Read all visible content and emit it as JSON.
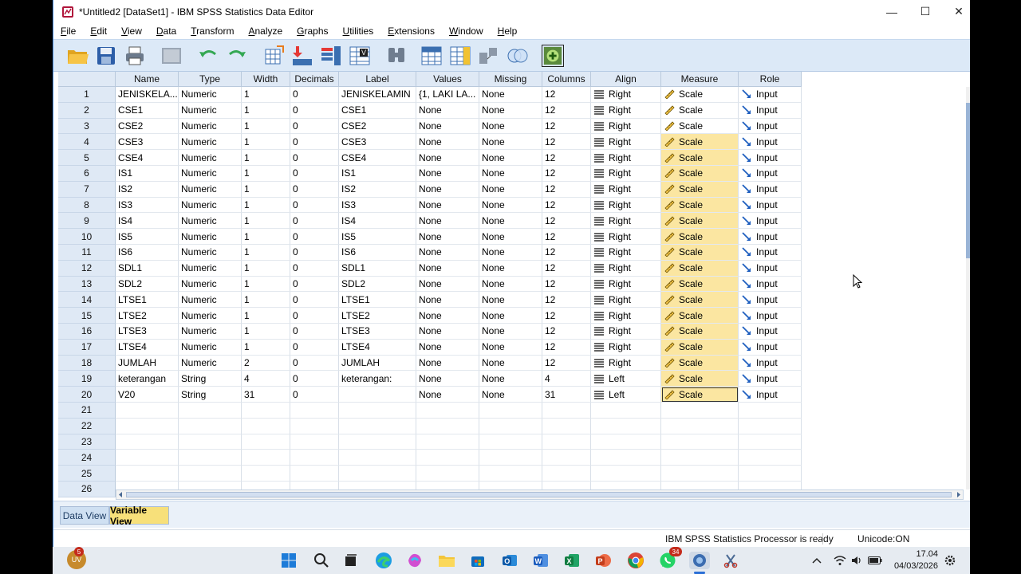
{
  "window": {
    "title": "*Untitled2 [DataSet1] - IBM SPSS Statistics Data Editor",
    "controls": {
      "minimize": "—",
      "maximize": "☐",
      "close": "✕"
    }
  },
  "menu": [
    {
      "label": "File"
    },
    {
      "label": "Edit"
    },
    {
      "label": "View"
    },
    {
      "label": "Data"
    },
    {
      "label": "Transform"
    },
    {
      "label": "Analyze"
    },
    {
      "label": "Graphs"
    },
    {
      "label": "Utilities"
    },
    {
      "label": "Extensions"
    },
    {
      "label": "Window"
    },
    {
      "label": "Help"
    }
  ],
  "toolbar_icons": [
    "open-folder-icon",
    "save-icon",
    "print-icon",
    "dialog-recall-icon",
    "undo-icon",
    "redo-icon",
    "goto-case-icon",
    "goto-variable-icon",
    "variables-icon",
    "run-descriptives-icon",
    "find-icon",
    "insert-cases-icon",
    "insert-variable-icon",
    "split-file-icon",
    "weight-cases-icon",
    "select-cases-icon",
    "add-icon"
  ],
  "table": {
    "headers": [
      "Name",
      "Type",
      "Width",
      "Decimals",
      "Label",
      "Values",
      "Missing",
      "Columns",
      "Align",
      "Measure",
      "Role"
    ],
    "rows": [
      [
        "1",
        "JENISKELA...",
        "Numeric",
        "1",
        "0",
        "JENISKELAMIN",
        "{1, LAKI LA...",
        "None",
        "12",
        "Right",
        "Scale",
        "Input"
      ],
      [
        "2",
        "CSE1",
        "Numeric",
        "1",
        "0",
        "CSE1",
        "None",
        "None",
        "12",
        "Right",
        "Scale",
        "Input"
      ],
      [
        "3",
        "CSE2",
        "Numeric",
        "1",
        "0",
        "CSE2",
        "None",
        "None",
        "12",
        "Right",
        "Scale",
        "Input"
      ],
      [
        "4",
        "CSE3",
        "Numeric",
        "1",
        "0",
        "CSE3",
        "None",
        "None",
        "12",
        "Right",
        "Scale",
        "Input"
      ],
      [
        "5",
        "CSE4",
        "Numeric",
        "1",
        "0",
        "CSE4",
        "None",
        "None",
        "12",
        "Right",
        "Scale",
        "Input"
      ],
      [
        "6",
        "IS1",
        "Numeric",
        "1",
        "0",
        "IS1",
        "None",
        "None",
        "12",
        "Right",
        "Scale",
        "Input"
      ],
      [
        "7",
        "IS2",
        "Numeric",
        "1",
        "0",
        "IS2",
        "None",
        "None",
        "12",
        "Right",
        "Scale",
        "Input"
      ],
      [
        "8",
        "IS3",
        "Numeric",
        "1",
        "0",
        "IS3",
        "None",
        "None",
        "12",
        "Right",
        "Scale",
        "Input"
      ],
      [
        "9",
        "IS4",
        "Numeric",
        "1",
        "0",
        "IS4",
        "None",
        "None",
        "12",
        "Right",
        "Scale",
        "Input"
      ],
      [
        "10",
        "IS5",
        "Numeric",
        "1",
        "0",
        "IS5",
        "None",
        "None",
        "12",
        "Right",
        "Scale",
        "Input"
      ],
      [
        "11",
        "IS6",
        "Numeric",
        "1",
        "0",
        "IS6",
        "None",
        "None",
        "12",
        "Right",
        "Scale",
        "Input"
      ],
      [
        "12",
        "SDL1",
        "Numeric",
        "1",
        "0",
        "SDL1",
        "None",
        "None",
        "12",
        "Right",
        "Scale",
        "Input"
      ],
      [
        "13",
        "SDL2",
        "Numeric",
        "1",
        "0",
        "SDL2",
        "None",
        "None",
        "12",
        "Right",
        "Scale",
        "Input"
      ],
      [
        "14",
        "LTSE1",
        "Numeric",
        "1",
        "0",
        "LTSE1",
        "None",
        "None",
        "12",
        "Right",
        "Scale",
        "Input"
      ],
      [
        "15",
        "LTSE2",
        "Numeric",
        "1",
        "0",
        "LTSE2",
        "None",
        "None",
        "12",
        "Right",
        "Scale",
        "Input"
      ],
      [
        "16",
        "LTSE3",
        "Numeric",
        "1",
        "0",
        "LTSE3",
        "None",
        "None",
        "12",
        "Right",
        "Scale",
        "Input"
      ],
      [
        "17",
        "LTSE4",
        "Numeric",
        "1",
        "0",
        "LTSE4",
        "None",
        "None",
        "12",
        "Right",
        "Scale",
        "Input"
      ],
      [
        "18",
        "JUMLAH",
        "Numeric",
        "2",
        "0",
        "JUMLAH",
        "None",
        "None",
        "12",
        "Right",
        "Scale",
        "Input"
      ],
      [
        "19",
        "keterangan",
        "String",
        "4",
        "0",
        "keterangan:",
        "None",
        "None",
        "4",
        "Left",
        "Scale",
        "Input"
      ],
      [
        "20",
        "V20",
        "String",
        "31",
        "0",
        "",
        "None",
        "None",
        "31",
        "Left",
        "Scale",
        "Input"
      ],
      [
        "21",
        "",
        "",
        "",
        "",
        "",
        "",
        "",
        "",
        "",
        "",
        ""
      ],
      [
        "22",
        "",
        "",
        "",
        "",
        "",
        "",
        "",
        "",
        "",
        "",
        ""
      ],
      [
        "23",
        "",
        "",
        "",
        "",
        "",
        "",
        "",
        "",
        "",
        "",
        ""
      ],
      [
        "24",
        "",
        "",
        "",
        "",
        "",
        "",
        "",
        "",
        "",
        "",
        ""
      ],
      [
        "25",
        "",
        "",
        "",
        "",
        "",
        "",
        "",
        "",
        "",
        "",
        ""
      ],
      [
        "26",
        "",
        "",
        "",
        "",
        "",
        "",
        "",
        "",
        "",
        "",
        ""
      ]
    ],
    "highlighted_measure_rows_from": 4,
    "selected_row": 20,
    "highlight_color": "#fbe6a1"
  },
  "tabs": [
    {
      "label": "Data View",
      "active": false
    },
    {
      "label": "Variable View",
      "active": true
    }
  ],
  "status": {
    "processor": "IBM SPSS Statistics Processor is ready",
    "unicode": "Unicode:ON"
  },
  "taskbar": {
    "profile_badge": "5",
    "whatsapp_badge": "34",
    "time": "17.04",
    "date": "04/03/2026"
  }
}
